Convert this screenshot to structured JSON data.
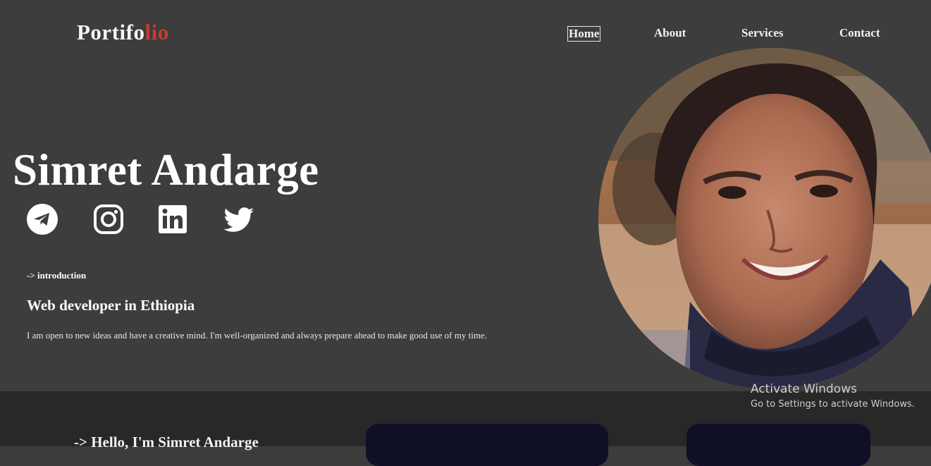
{
  "header": {
    "logo_main": "Portifo",
    "logo_accent": "lio",
    "nav": [
      {
        "label": "Home",
        "active": true
      },
      {
        "label": "About",
        "active": false
      },
      {
        "label": "Services",
        "active": false
      },
      {
        "label": "Contact",
        "active": false
      }
    ]
  },
  "hero": {
    "name": "Simret Andarge",
    "social_icons": [
      "telegram-icon",
      "instagram-icon",
      "linkedin-icon",
      "twitter-icon"
    ],
    "intro_tag": "-> introduction",
    "headline": "Web developer in Ethiopia",
    "description": "I am open to new ideas and have a creative mind. I'm well-organized and always prepare ahead to make good use of my time."
  },
  "about": {
    "hello": "-> Hello, I'm Simret Andarge"
  },
  "watermark": {
    "title": "Activate Windows",
    "subtitle": "Go to Settings to activate Windows."
  },
  "colors": {
    "background": "#3c3d3c",
    "accent": "#c83b33",
    "section_dark": "#282828",
    "card": "#0f0f28"
  }
}
